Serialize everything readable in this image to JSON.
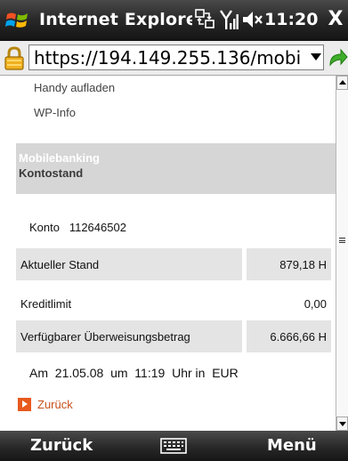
{
  "titlebar": {
    "app_title": "Internet Explorer",
    "clock": "11:20",
    "close_label": "X"
  },
  "addressbar": {
    "url": "https://194.149.255.136/mobile"
  },
  "content": {
    "links": [
      "Handy aufladen",
      "WP-Info"
    ],
    "header": {
      "supertitle": "Mobilebanking",
      "title": "Kontostand"
    },
    "account": {
      "label": "Konto",
      "number": "112646502"
    },
    "rows": [
      {
        "label": "Aktueller Stand",
        "value": "879,18 H"
      },
      {
        "label": "Kreditlimit",
        "value": "0,00"
      },
      {
        "label": "Verfügbarer Überweisungsbetrag",
        "value": "6.666,66 H"
      }
    ],
    "date_line": {
      "prefix": "Am",
      "date": "21.05.08",
      "mid": "um",
      "time": "11:19",
      "suffix": "Uhr in",
      "currency": "EUR"
    },
    "back_label": "Zurück"
  },
  "softkeys": {
    "left": "Zurück",
    "center_icon": "keyboard-icon",
    "right": "Menü"
  },
  "colors": {
    "accent_orange": "#e8591e",
    "bar_dark": "#1e1e1e",
    "shade": "#e4e4e4",
    "header_bg": "#d6d6d6"
  }
}
